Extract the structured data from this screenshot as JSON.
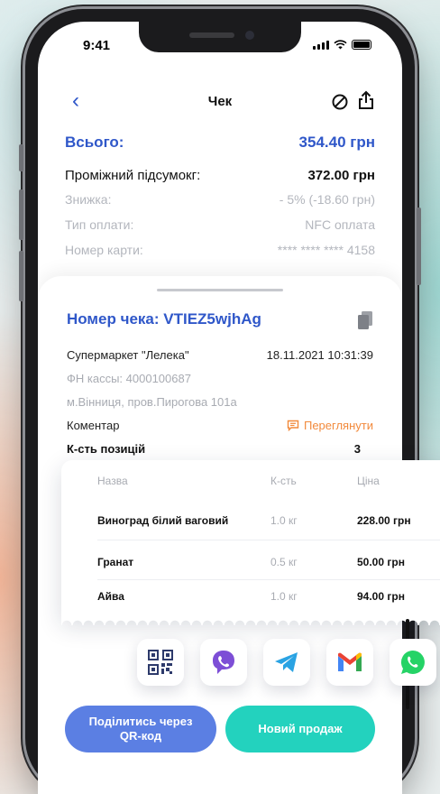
{
  "status_bar": {
    "time": "9:41"
  },
  "nav": {
    "back_icon": "chevron-left-icon",
    "title": "Чек",
    "cancel_icon": "cancel-circle-icon",
    "share_icon": "share-icon"
  },
  "summary": {
    "total_label": "Всього:",
    "total_value": "354.40 грн",
    "subtotal_label": "Проміжний підсумокг:",
    "subtotal_value": "372.00 грн",
    "discount_label": "Знижка:",
    "discount_value": "- 5% (-18.60 грн)",
    "payment_label": "Тип оплати:",
    "payment_value": "NFC оплата",
    "card_label": "Номер карти:",
    "card_value": "**** **** **** 4158"
  },
  "receipt": {
    "title": "Номер чека: VTIEZ5wjhAg",
    "store": "Супермаркет \"Лелека\"",
    "datetime": "18.11.2021 10:31:39",
    "fiscal": "ФН кассы: 4000100687",
    "address": "м.Вінниця, пров.Пирогова 101а",
    "comment_label": "Коментар",
    "view_label": "Переглянути",
    "count_label": "К-сть позицій",
    "count_value": "3"
  },
  "items_table": {
    "headers": [
      "Назва",
      "К-сть",
      "Ціна"
    ],
    "rows": [
      {
        "name": "Виноград білий ваговий",
        "qty": "1.0 кг",
        "price": "228.00 грн"
      },
      {
        "name": "Гранат",
        "qty": "0.5 кг",
        "price": "50.00 грн"
      },
      {
        "name": "Айва",
        "qty": "1.0 кг",
        "price": "94.00 грн"
      }
    ]
  },
  "share_options": [
    "qr-code-icon",
    "viber-icon",
    "telegram-icon",
    "gmail-icon",
    "whatsapp-icon"
  ],
  "actions": {
    "share_qr": "Поділитись через QR-код",
    "new_sale": "Новий продаж"
  },
  "colors": {
    "accent_blue": "#2f57c9",
    "button_blue": "#5b7fe3",
    "button_teal": "#23d2be",
    "link_orange": "#f28a3c"
  }
}
